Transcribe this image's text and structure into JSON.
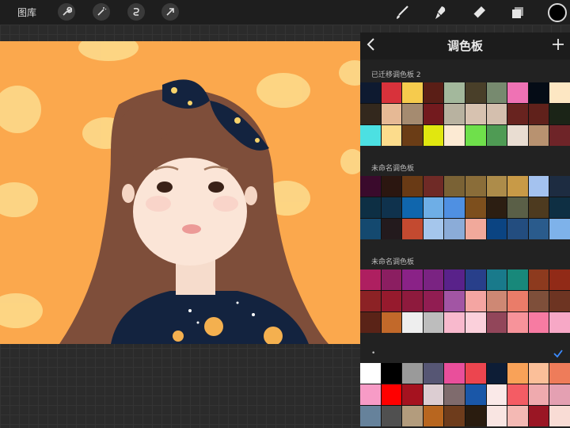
{
  "toolbar": {
    "gallery_label": "图库",
    "brush_icon": "brush-icon",
    "smudge_icon": "smudge-icon",
    "eraser_icon": "eraser-icon",
    "layers_icon": "layers-icon",
    "color": "#000000"
  },
  "panel": {
    "title": "调色板"
  },
  "palettes": [
    {
      "name": "已迁移调色板 2",
      "colors": [
        "#0e1a30",
        "#d8323b",
        "#f6cb4d",
        "#5a1e16",
        "#a3b89c",
        "#493f29",
        "#778a6f",
        "#ef72b4",
        "#050c16",
        "#fde7c3",
        "#33281d",
        "#e6b995",
        "#a58b70",
        "#731a1e",
        "#b8b2a0",
        "#d7c2b0",
        "#d4bfae",
        "#68231f",
        "#60211b",
        "#1b2417",
        "#4ce0e2",
        "#fcdc8c",
        "#6b3d16",
        "#e1e70f",
        "#fcead3",
        "#6fe04b",
        "#4f9b54",
        "#e9ddd2",
        "#b89270",
        "#6e2428"
      ]
    },
    {
      "name": "未命名调色板",
      "colors": [
        "#3a0a2c",
        "#2b1610",
        "#693a15",
        "#6f2a26",
        "#7a6235",
        "#8a6d39",
        "#ad8c4a",
        "#c89a47",
        "#a4c2ef",
        "#1d2c41",
        "#0d2f44",
        "#0f324d",
        "#1066ad",
        "#6eaee6",
        "#4f90e2",
        "#7d4f1d",
        "#2c1e12",
        "#5a5f47",
        "#4d3a1f",
        "#0e2f43",
        "#14496f",
        "#231a1d",
        "#c34a30",
        "#a5c6ec",
        "#8bacd8",
        "#f1a99b",
        "#0b4482",
        "#234d7f",
        "#2a5b8c",
        "#7eb2ea"
      ]
    },
    {
      "name": "未命名调色板",
      "colors": [
        "#ae1f60",
        "#8b1e61",
        "#8a2287",
        "#7a2382",
        "#59228a",
        "#283f8a",
        "#197a8b",
        "#18887a",
        "#8d3a1e",
        "#912a17",
        "#8c2225",
        "#961a2d",
        "#8e1a3d",
        "#911d52",
        "#a255a4",
        "#f4a5a2",
        "#ce8874",
        "#ea7c69",
        "#7e4f3a",
        "#6d3422",
        "#5a2317",
        "#c2692a",
        "#eeeeee",
        "#bdbdbd",
        "#f8b9cd",
        "#fbd0db",
        "#92465a",
        "#f7939a",
        "#f77ba2",
        "#f7a8c6"
      ]
    },
    {
      "name": "•",
      "active": true,
      "colors": [
        "#ffffff",
        "#000000",
        "#9a9a9a",
        "#565674",
        "#e94f9b",
        "#ec454f",
        "#0d1d36",
        "#f9a258",
        "#fbbf99",
        "#ee7c5a",
        "#f79bc6",
        "#ff0000",
        "#a5121f",
        "#dccdd2",
        "#7f6b6d",
        "#1a57a8",
        "#fae9e8",
        "#f45c64",
        "#efaaae",
        "#e4a0b2",
        "#66829b",
        "#505050",
        "#b39c7d",
        "#b8661f",
        "#6e3c1c",
        "#2a1c0f",
        "#f9e5e2",
        "#f4b9b4",
        "#9a1624",
        "#f9dcd5"
      ]
    }
  ]
}
